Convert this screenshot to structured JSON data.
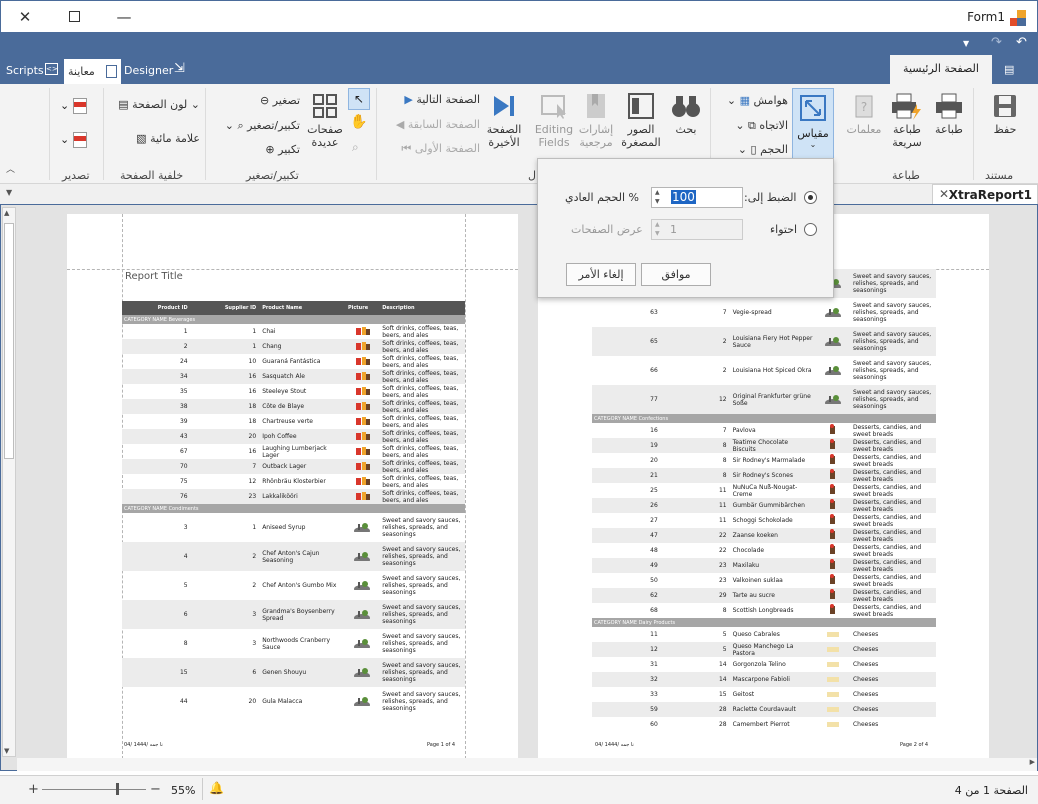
{
  "window": {
    "title": "Form1"
  },
  "quickbar": {
    "scripts": "Scripts",
    "preview": "معاينة",
    "designer": "Designer"
  },
  "tabs": {
    "home": "الصفحة الرئيسية"
  },
  "ribbon": {
    "save": "حفظ",
    "print": "طباعة",
    "quick_print": [
      "طباعة",
      "سريعة"
    ],
    "params": "معلمات",
    "scale": "مقياس",
    "margins": "هوامش",
    "orientation": "الاتجاه",
    "size": "الحجم",
    "search": "بحث",
    "thumbnails": [
      "الصور",
      "المصغرة"
    ],
    "bookmarks": [
      "إشارات",
      "مرجعية"
    ],
    "editing": [
      "Editing",
      "Fields"
    ],
    "last_page": [
      "الصفحة",
      "الأخيرة"
    ],
    "next_page": "الصفحة التالية",
    "prev_page": "الصفحة السابقة",
    "first_page": "الصفحة الأولى",
    "multi_pages": [
      "صفحات",
      "عديدة"
    ],
    "zoom_out": "تصغير",
    "zoom": "تكبير/تصغير",
    "zoom_in": "تكبير",
    "page_color": "لون الصفحة",
    "watermark": "علامة مائية",
    "groups": {
      "document": "مستند",
      "print": "طباعة",
      "zoom": "تكبير/تصغير",
      "background": "خلفية الصفحة",
      "export": "تصدير"
    }
  },
  "doc_tab": {
    "name": "XtraReport1"
  },
  "scale_popup": {
    "adjust_label": "الضبط إلى:",
    "adjust_value": "100",
    "adjust_suffix": "% الحجم العادي",
    "fit_label": "احتواء",
    "fit_value": "1",
    "fit_suffix": "عرض الصفحات",
    "ok": "موافق",
    "cancel": "إلغاء الأمر"
  },
  "colors": {
    "accent": "#4a6b9a",
    "active": "#cfe3f6"
  },
  "report": {
    "title": "Report Title",
    "columns": [
      "Product ID",
      "Supplier ID",
      "Product Name",
      "Picture",
      "Description"
    ],
    "cat_prefix": "CATEGORY NAME",
    "footer_date": "04/ 1444/ نا جمه",
    "page1": {
      "footer": "Page 1 of 4",
      "groups": [
        {
          "category": "Beverages",
          "rows": [
            [
              "1",
              "1",
              "Chai",
              "Soft drinks, coffees, teas, beers, and ales"
            ],
            [
              "2",
              "1",
              "Chang",
              "Soft drinks, coffees, teas, beers, and ales"
            ],
            [
              "24",
              "10",
              "Guaraná Fantástica",
              "Soft drinks, coffees, teas, beers, and ales"
            ],
            [
              "34",
              "16",
              "Sasquatch Ale",
              "Soft drinks, coffees, teas, beers, and ales"
            ],
            [
              "35",
              "16",
              "Steeleye Stout",
              "Soft drinks, coffees, teas, beers, and ales"
            ],
            [
              "38",
              "18",
              "Côte de Blaye",
              "Soft drinks, coffees, teas, beers, and ales"
            ],
            [
              "39",
              "18",
              "Chartreuse verte",
              "Soft drinks, coffees, teas, beers, and ales"
            ],
            [
              "43",
              "20",
              "Ipoh Coffee",
              "Soft drinks, coffees, teas, beers, and ales"
            ],
            [
              "67",
              "16",
              "Laughing Lumberjack Lager",
              "Soft drinks, coffees, teas, beers, and ales"
            ],
            [
              "70",
              "7",
              "Outback Lager",
              "Soft drinks, coffees, teas, beers, and ales"
            ],
            [
              "75",
              "12",
              "Rhönbräu Klosterbier",
              "Soft drinks, coffees, teas, beers, and ales"
            ],
            [
              "76",
              "23",
              "Lakkalikööri",
              "Soft drinks, coffees, teas, beers, and ales"
            ]
          ]
        },
        {
          "category": "Condiments",
          "rows": [
            [
              "3",
              "1",
              "Aniseed Syrup",
              "Sweet and savory sauces, relishes, spreads, and seasonings"
            ],
            [
              "4",
              "2",
              "Chef Anton's Cajun Seasoning",
              "Sweet and savory sauces, relishes, spreads, and seasonings"
            ],
            [
              "5",
              "2",
              "Chef Anton's Gumbo Mix",
              "Sweet and savory sauces, relishes, spreads, and seasonings"
            ],
            [
              "6",
              "3",
              "Grandma's Boysenberry Spread",
              "Sweet and savory sauces, relishes, spreads, and seasonings"
            ],
            [
              "8",
              "3",
              "Northwoods Cranberry Sauce",
              "Sweet and savory sauces, relishes, spreads, and seasonings"
            ],
            [
              "15",
              "6",
              "Genen Shouyu",
              "Sweet and savory sauces, relishes, spreads, and seasonings"
            ],
            [
              "44",
              "20",
              "Gula Malacca",
              "Sweet and savory sauces, relishes, spreads, and seasonings"
            ]
          ]
        }
      ]
    },
    "page2": {
      "footer": "Page 2 of 4",
      "top_rows": [
        [
          "",
          "",
          "",
          "Sweet and savory sauces, relishes, spreads, and seasonings"
        ],
        [
          "63",
          "7",
          "Vegie-spread",
          "Sweet and savory sauces, relishes, spreads, and seasonings"
        ],
        [
          "65",
          "2",
          "Louisiana Fiery Hot Pepper Sauce",
          "Sweet and savory sauces, relishes, spreads, and seasonings"
        ],
        [
          "66",
          "2",
          "Louisiana Hot Spiced Okra",
          "Sweet and savory sauces, relishes, spreads, and seasonings"
        ],
        [
          "77",
          "12",
          "Original Frankfurter grüne Soße",
          "Sweet and savory sauces, relishes, spreads, and seasonings"
        ]
      ],
      "groups": [
        {
          "category": "Confections",
          "rows": [
            [
              "16",
              "7",
              "Pavlova",
              "Desserts, candies, and sweet breads"
            ],
            [
              "19",
              "8",
              "Teatime Chocolate Biscuits",
              "Desserts, candies, and sweet breads"
            ],
            [
              "20",
              "8",
              "Sir Rodney's Marmalade",
              "Desserts, candies, and sweet breads"
            ],
            [
              "21",
              "8",
              "Sir Rodney's Scones",
              "Desserts, candies, and sweet breads"
            ],
            [
              "25",
              "11",
              "NuNuCa Nuß-Nougat-Creme",
              "Desserts, candies, and sweet breads"
            ],
            [
              "26",
              "11",
              "Gumbär Gummibärchen",
              "Desserts, candies, and sweet breads"
            ],
            [
              "27",
              "11",
              "Schoggi Schokolade",
              "Desserts, candies, and sweet breads"
            ],
            [
              "47",
              "22",
              "Zaanse koeken",
              "Desserts, candies, and sweet breads"
            ],
            [
              "48",
              "22",
              "Chocolade",
              "Desserts, candies, and sweet breads"
            ],
            [
              "49",
              "23",
              "Maxilaku",
              "Desserts, candies, and sweet breads"
            ],
            [
              "50",
              "23",
              "Valkoinen suklaa",
              "Desserts, candies, and sweet breads"
            ],
            [
              "62",
              "29",
              "Tarte au sucre",
              "Desserts, candies, and sweet breads"
            ],
            [
              "68",
              "8",
              "Scottish Longbreads",
              "Desserts, candies, and sweet breads"
            ]
          ]
        },
        {
          "category": "Dairy Products",
          "rows": [
            [
              "11",
              "5",
              "Queso Cabrales",
              "Cheeses"
            ],
            [
              "12",
              "5",
              "Queso Manchego La Pastora",
              "Cheeses"
            ],
            [
              "31",
              "14",
              "Gorgonzola Telino",
              "Cheeses"
            ],
            [
              "32",
              "14",
              "Mascarpone Fabioli",
              "Cheeses"
            ],
            [
              "33",
              "15",
              "Geitost",
              "Cheeses"
            ],
            [
              "59",
              "28",
              "Raclette Courdavault",
              "Cheeses"
            ],
            [
              "60",
              "28",
              "Camembert Pierrot",
              "Cheeses"
            ]
          ]
        }
      ]
    }
  },
  "status": {
    "zoom": "55%",
    "page_info": "الصفحة 1 من 4"
  }
}
